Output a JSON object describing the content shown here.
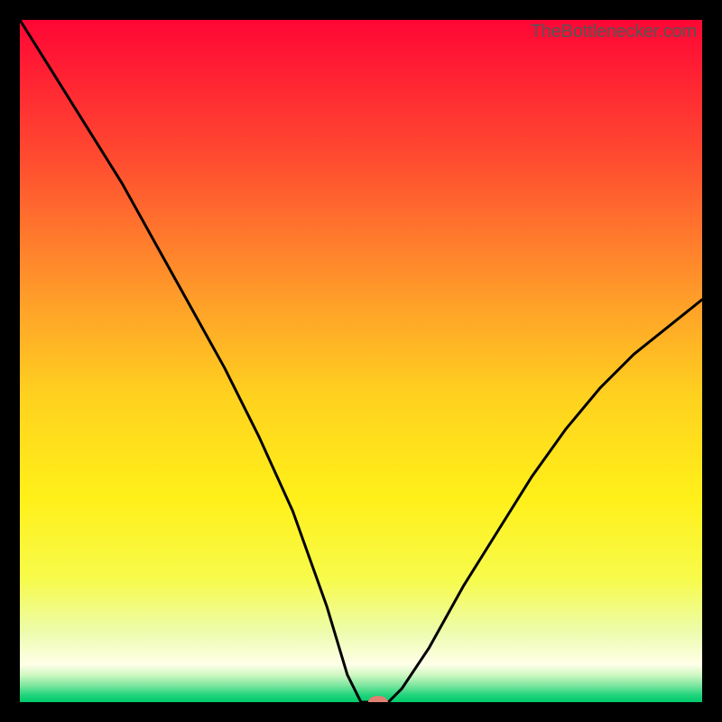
{
  "attribution": "TheBottlenecker.com",
  "chart_data": {
    "type": "line",
    "title": "",
    "xlabel": "",
    "ylabel": "",
    "xlim": [
      0,
      100
    ],
    "ylim": [
      0,
      100
    ],
    "series": [
      {
        "name": "curve",
        "x": [
          0,
          5,
          10,
          15,
          20,
          25,
          30,
          35,
          40,
          45,
          48,
          50,
          52,
          54,
          56,
          60,
          65,
          70,
          75,
          80,
          85,
          90,
          95,
          100
        ],
        "y": [
          100,
          92,
          84,
          76,
          67,
          58,
          49,
          39,
          28,
          14,
          4,
          0,
          0,
          0,
          2,
          8,
          17,
          25,
          33,
          40,
          46,
          51,
          55,
          59
        ]
      }
    ],
    "marker": {
      "x": 52.5,
      "y": 0
    },
    "background": {
      "type": "vertical-gradient",
      "stops": [
        {
          "pos": 0.0,
          "color": "#ff0635"
        },
        {
          "pos": 0.2,
          "color": "#ff4a30"
        },
        {
          "pos": 0.4,
          "color": "#ff9a2a"
        },
        {
          "pos": 0.55,
          "color": "#ffd11f"
        },
        {
          "pos": 0.7,
          "color": "#fff019"
        },
        {
          "pos": 0.82,
          "color": "#f7fb4b"
        },
        {
          "pos": 0.9,
          "color": "#edfcb0"
        },
        {
          "pos": 0.945,
          "color": "#ffffe8"
        },
        {
          "pos": 0.96,
          "color": "#cff7c2"
        },
        {
          "pos": 0.975,
          "color": "#7fe7a0"
        },
        {
          "pos": 0.99,
          "color": "#1fd47b"
        },
        {
          "pos": 1.0,
          "color": "#00c96b"
        }
      ]
    }
  }
}
